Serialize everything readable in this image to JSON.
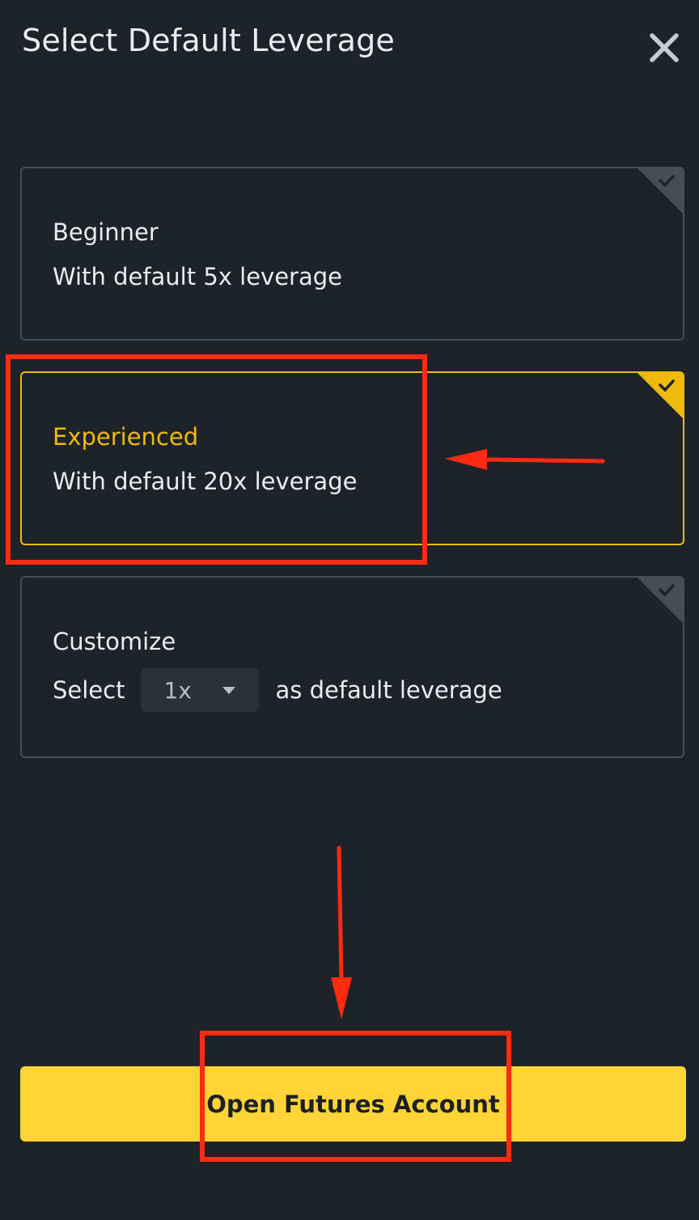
{
  "header": {
    "title": "Select Default Leverage",
    "close_icon": "close-icon"
  },
  "options": {
    "beginner": {
      "title": "Beginner",
      "description": "With default 5x leverage",
      "selected": false
    },
    "experienced": {
      "title": "Experienced",
      "description": "With default 20x leverage",
      "selected": true
    },
    "customize": {
      "title": "Customize",
      "prefix": "Select",
      "dropdown_value": "1x",
      "suffix": "as default leverage",
      "selected": false
    }
  },
  "footer": {
    "button_label": "Open Futures Account"
  },
  "colors": {
    "background": "#1e2229",
    "accent": "#f0b90b",
    "button": "#fcd535",
    "card_border": "#474d57",
    "annotation": "#ff2a12"
  }
}
